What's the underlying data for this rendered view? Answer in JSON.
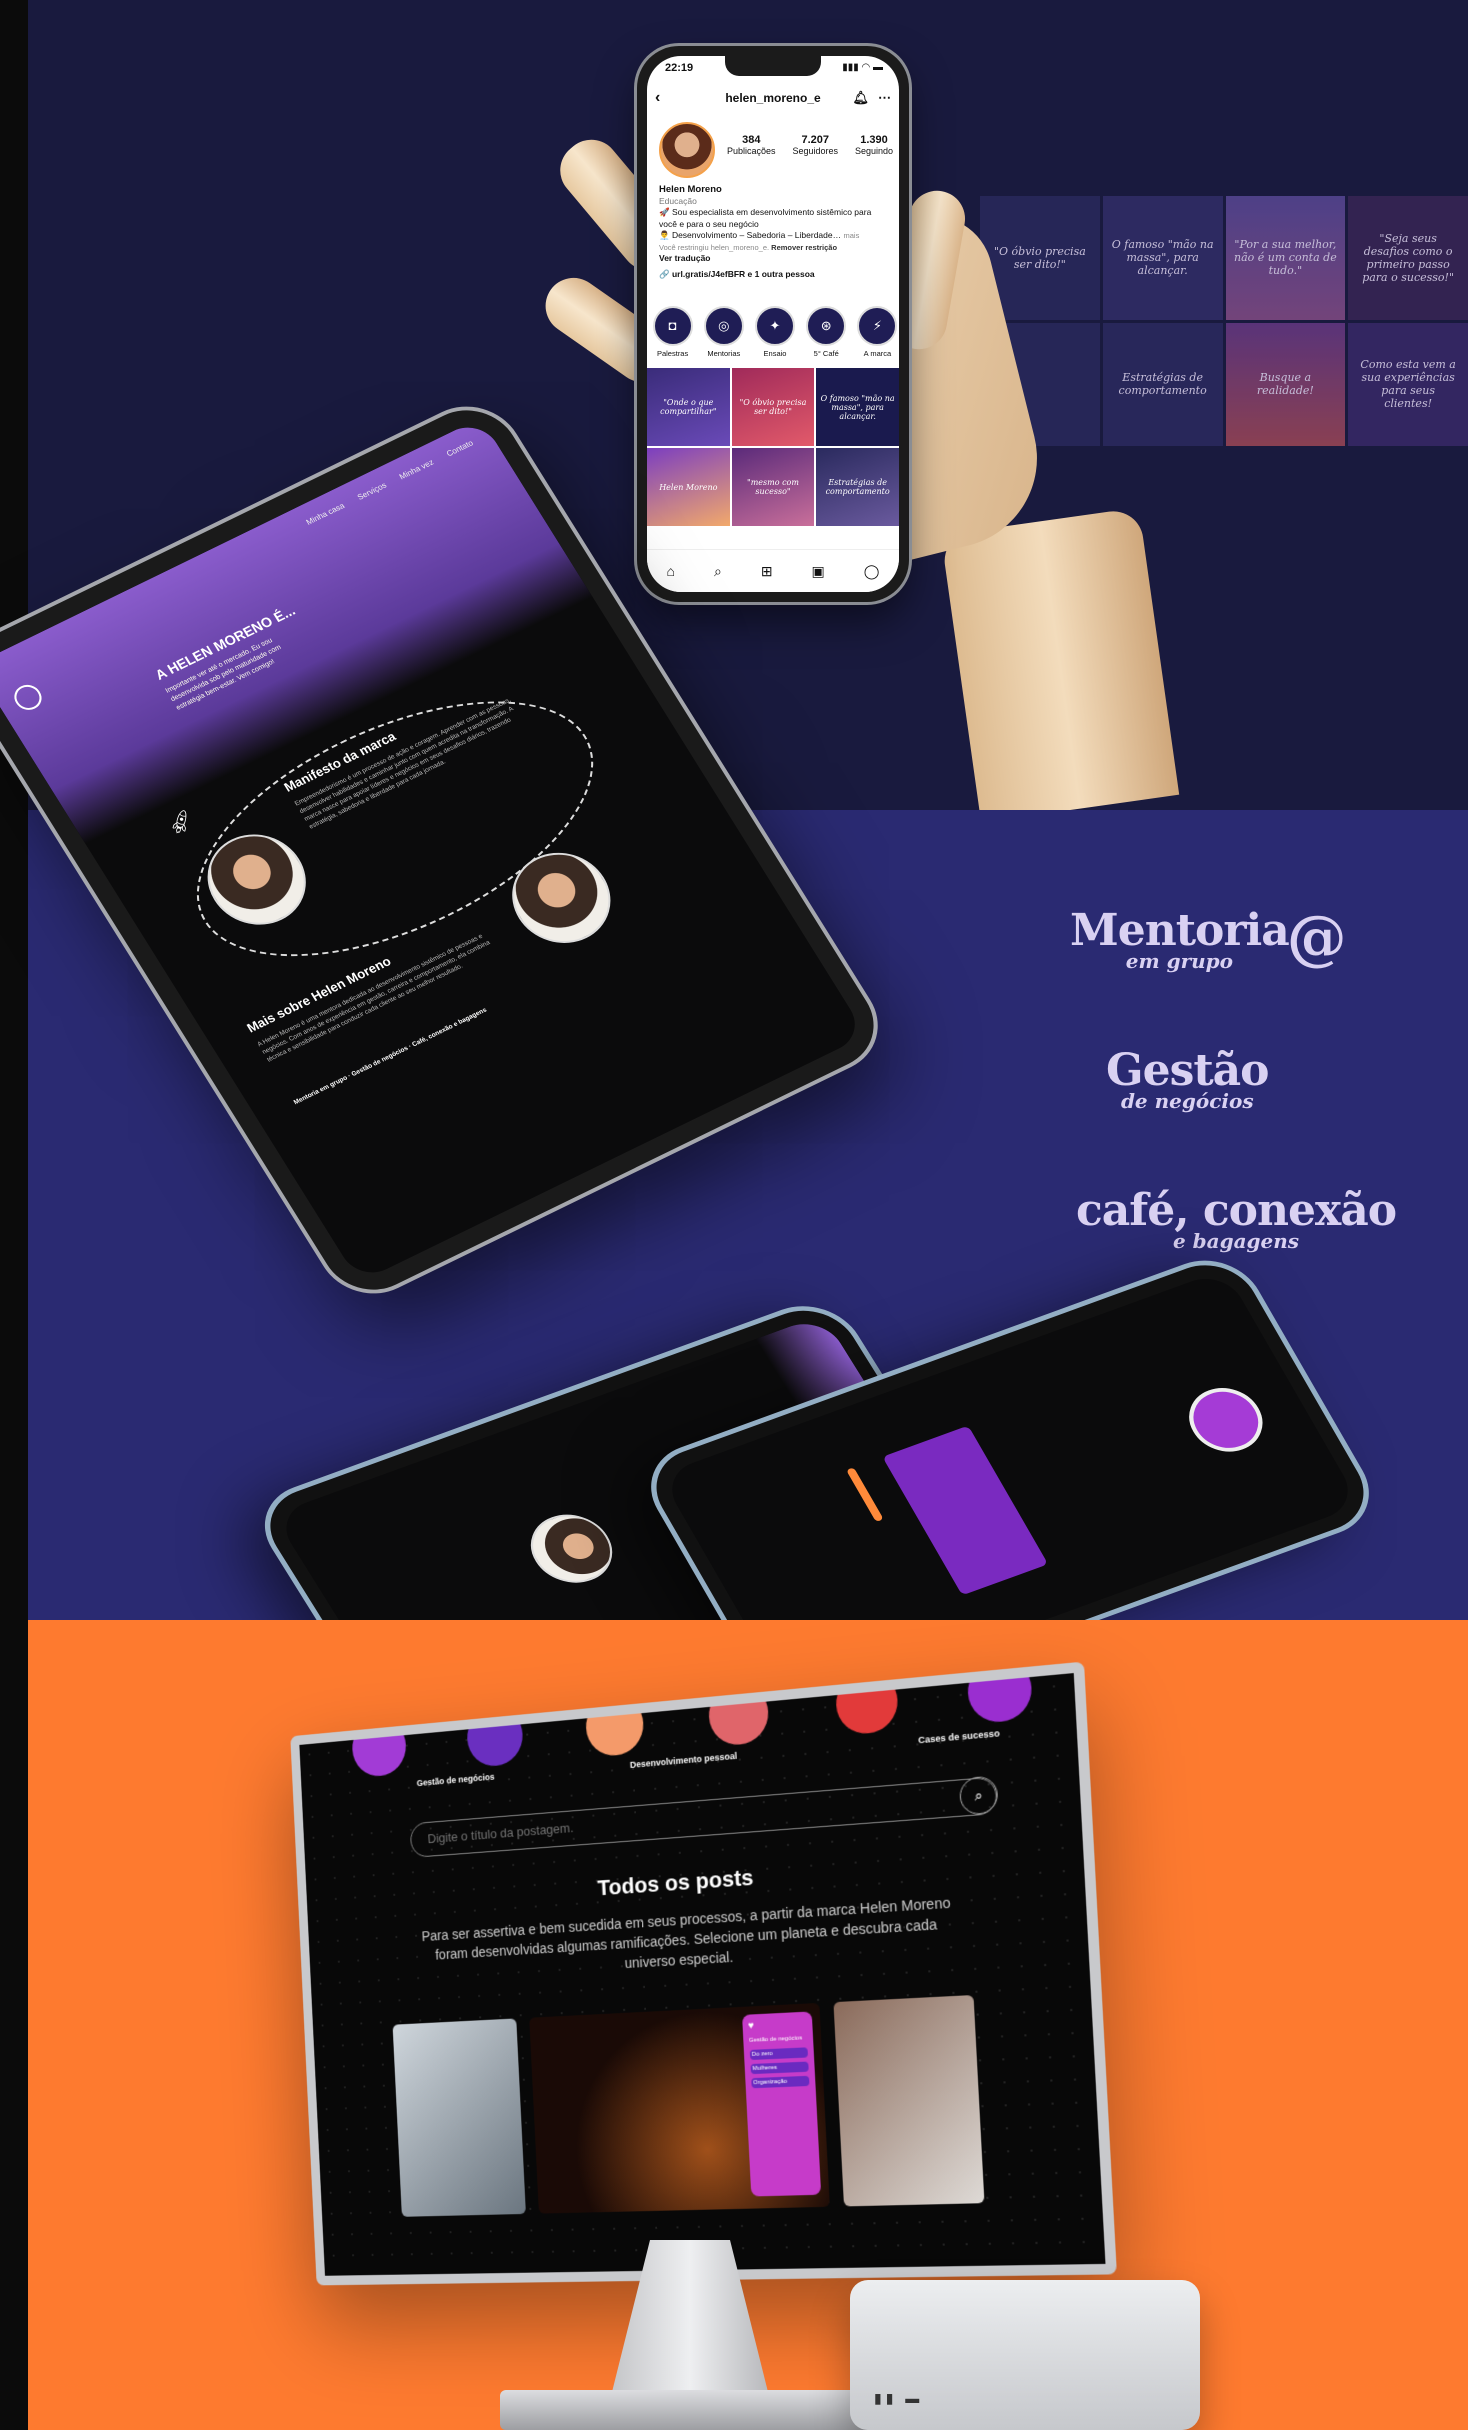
{
  "phone": {
    "time": "22:19",
    "username": "helen_moreno_e",
    "stats": [
      {
        "value": "384",
        "label": "Publicações"
      },
      {
        "value": "7.207",
        "label": "Seguidores"
      },
      {
        "value": "1.390",
        "label": "Seguindo"
      }
    ],
    "bio": {
      "name": "Helen Moreno",
      "category": "Educação",
      "line1": "🚀 Sou especialista em desenvolvimento sistêmico para você e para o seu negócio",
      "line2": "👨‍💼 Desenvolvimento – Sabedoria – Liberdade…",
      "more": "mais",
      "restricted": "Você restringiu helen_moreno_e.",
      "remove": "Remover restrição",
      "translate": "Ver tradução",
      "link": "url.gratis/J4efBFR e 1 outra pessoa"
    },
    "highlights": [
      "Palestras",
      "Mentorias",
      "Ensaio",
      "5° Café",
      "A marca"
    ],
    "posts": [
      "\"Onde o que compartilhar\"",
      "\"O óbvio precisa ser dito!\"",
      "O famoso \"mão na massa\", para alcançar.",
      "Helen Moreno",
      "\"mesmo com sucesso\"",
      "Estratégias de comportamento"
    ]
  },
  "instagram_grid": [
    "\"O óbvio precisa ser dito!\"",
    "O famoso \"mão na massa\", para alcançar.",
    "\"Por a sua melhor, não é um conta de tudo.\"",
    "\"Seja seus desafios como o primeiro passo para o sucesso!\"",
    "",
    "Estratégias de comportamento",
    "Busque a realidade!",
    "Como esta vem a sua experiências para seus clientes!"
  ],
  "tablet": {
    "nav": [
      "Minha casa",
      "Serviços",
      "Minha vez",
      "Contato"
    ],
    "hero_title": "A HELEN MORENO É...",
    "hero_sub": "Importante ver até o mercado. Eu sou desenvolvida sob pelo maturidade com estratégia bem-estar. Vem comigo!",
    "section1_title": "Manifesto da marca",
    "section1_text": "Empreendedorismo é um processo de ação e coragem. Aprender com as pessoas, desenvolver habilidades e caminhar junto com quem acredita na transformação. A marca nasce para apoiar líderes e negócios em seus desafios diários, trazendo estratégia, sabedoria e liberdade para cada jornada.",
    "section2_title": "Mais sobre Helen Moreno",
    "section2_text": "A Helen Moreno é uma mentora dedicada ao desenvolvimento sistêmico de pessoas e negócios. Com anos de experiência em gestão, carreira e comportamento, ela combina técnica e sensibilidade para conduzir cada cliente ao seu melhor resultado.",
    "section2_bold": "Mentoria em grupo · Gestão de negócios · Café, conexão e bagagens"
  },
  "brands": [
    {
      "big": "Mentoria",
      "small": "em grupo"
    },
    {
      "big": "Gestão",
      "small": "de negócios"
    },
    {
      "big": "café, conexão",
      "small": "e bagagens"
    }
  ],
  "monitor": {
    "planet_labels": [
      "Gestão de negócios",
      "Desenvolvimento pessoal",
      "Cases de sucesso"
    ],
    "search_placeholder": "Digite o título da postagem.",
    "title": "Todos os posts",
    "description": "Para ser assertiva e bem sucedida em seus processos, a partir da marca Helen Moreno foram desenvolvidas algumas ramificações. Selecione um planeta e descubra cada universo especial.",
    "card_menu": [
      "Gestão de negócios",
      "Do zero",
      "Mulheres",
      "Organização"
    ]
  },
  "colors": {
    "section1_bg": "#191a3e",
    "section2_bg": "#2a2a72",
    "section3_bg": "#fe7a2f",
    "accent_purple": "#8a5ccc"
  }
}
